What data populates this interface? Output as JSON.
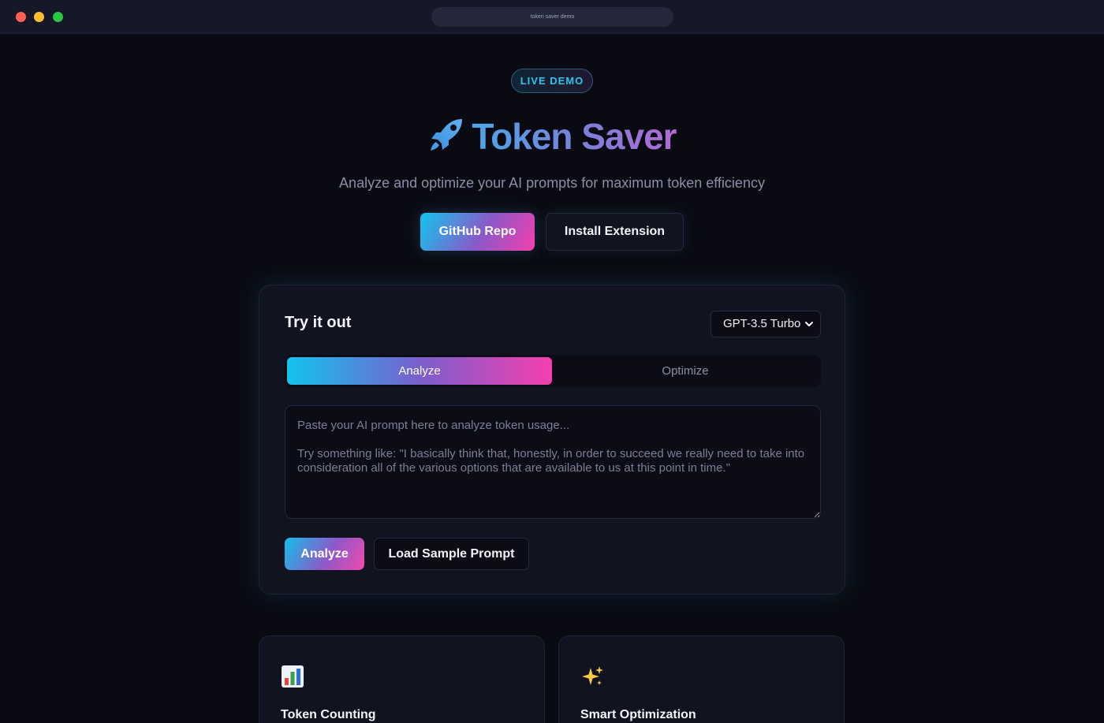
{
  "window": {
    "url": "token saver demo"
  },
  "hero": {
    "badge": "LIVE DEMO",
    "rocket_icon": "rocket-icon",
    "title": "Token Saver",
    "subtitle": "Analyze and optimize your AI prompts for maximum token efficiency",
    "github_button": "GitHub Repo",
    "install_button": "Install Extension"
  },
  "demo": {
    "title": "Try it out",
    "model_selected": "GPT-3.5 Turbo",
    "tabs": [
      {
        "label": "Analyze",
        "active": true
      },
      {
        "label": "Optimize",
        "active": false
      }
    ],
    "prompt_placeholder": "Paste your AI prompt here to analyze token usage...\n\nTry something like: \"I basically think that, honestly, in order to succeed we really need to take into consideration all of the various options that are available to us at this point in time.\"",
    "analyze_button": "Analyze",
    "sample_button": "Load Sample Prompt"
  },
  "features": [
    {
      "icon": "bar-chart-icon",
      "title": "Token Counting"
    },
    {
      "icon": "sparkles-icon",
      "title": "Smart Optimization"
    }
  ],
  "colors": {
    "background": "#0a0b12",
    "card": "#111320",
    "accent_cyan": "#11c5ee",
    "accent_pink": "#f53fae",
    "badge_text": "#2fc4ef"
  }
}
